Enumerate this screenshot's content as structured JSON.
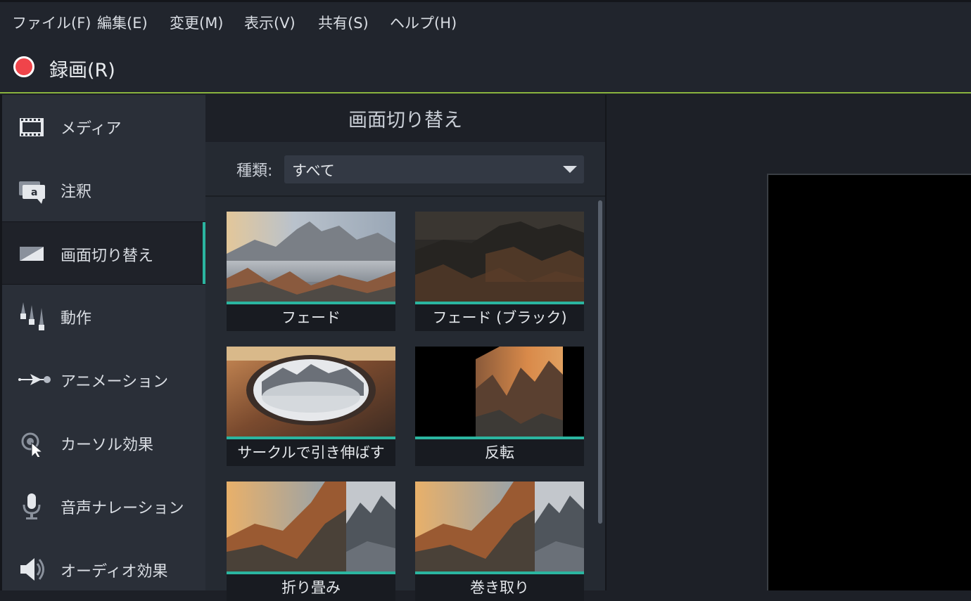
{
  "menu": [
    "ファイル(F)",
    "編集(E)",
    "変更(M)",
    "表示(V)",
    "共有(S)",
    "ヘルプ(H)"
  ],
  "record": {
    "label": "録画(R)",
    "color": "#f0444a"
  },
  "sidebar": {
    "items": [
      {
        "label": "メディア",
        "icon": "film-icon"
      },
      {
        "label": "注釈",
        "icon": "callout-icon"
      },
      {
        "label": "画面切り替え",
        "icon": "transition-icon",
        "active": true
      },
      {
        "label": "動作",
        "icon": "behavior-icon"
      },
      {
        "label": "アニメーション",
        "icon": "animation-icon"
      },
      {
        "label": "カーソル効果",
        "icon": "cursor-effect-icon"
      },
      {
        "label": "音声ナレーション",
        "icon": "microphone-icon"
      },
      {
        "label": "オーディオ効果",
        "icon": "speaker-icon"
      }
    ]
  },
  "panel": {
    "title": "画面切り替え",
    "filter_label": "種類:",
    "filter_value": "すべて"
  },
  "transitions": [
    {
      "label": "フェード"
    },
    {
      "label": "フェード (ブラック)"
    },
    {
      "label": "サークルで引き伸ばす"
    },
    {
      "label": "反転"
    },
    {
      "label": "折り畳み"
    },
    {
      "label": "巻き取り"
    }
  ],
  "colors": {
    "accent": "#2bb5a0",
    "active_line": "#8ab43e"
  }
}
